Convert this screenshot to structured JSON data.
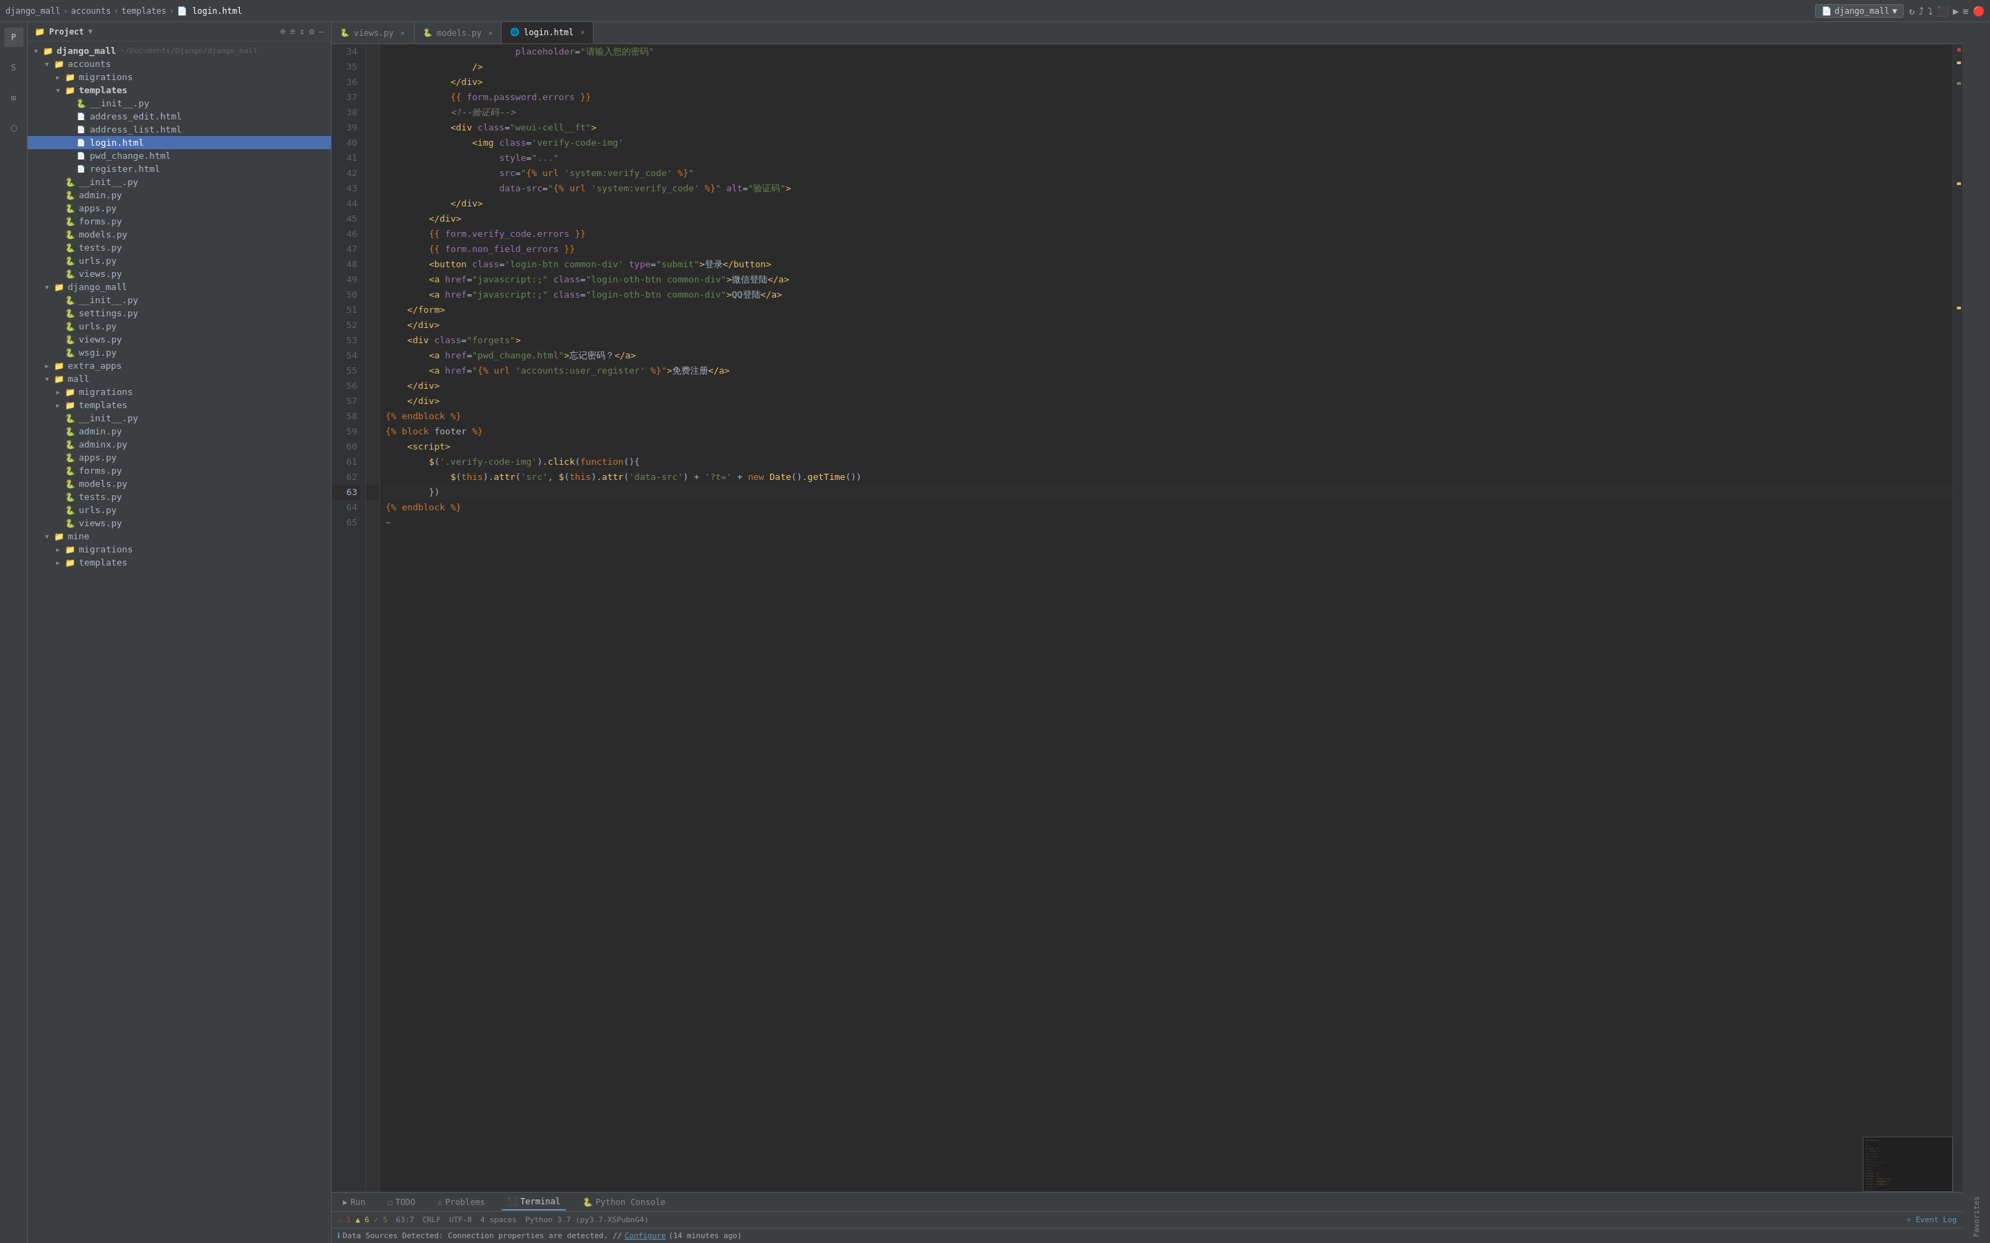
{
  "topbar": {
    "breadcrumbs": [
      "django_mall",
      "accounts",
      "templates",
      "login.html"
    ],
    "project_label": "django_mall",
    "icons": [
      "↻",
      "⤴",
      "⤵",
      "≡",
      "▼",
      "🔴"
    ]
  },
  "sidebar": {
    "header_title": "Project",
    "icons": [
      "⊕",
      "≡",
      "↕",
      "⚙",
      "—"
    ],
    "tree": [
      {
        "id": "django_mall_root",
        "label": "django_mall",
        "indent": 0,
        "type": "folder",
        "expanded": true,
        "suffix": "~/Documents/Django/django_mall"
      },
      {
        "id": "accounts",
        "label": "accounts",
        "indent": 1,
        "type": "folder",
        "expanded": true
      },
      {
        "id": "migrations_acc",
        "label": "migrations",
        "indent": 2,
        "type": "folder",
        "expanded": false
      },
      {
        "id": "templates_acc",
        "label": "templates",
        "indent": 2,
        "type": "folder",
        "expanded": true
      },
      {
        "id": "__init__py_tmpl",
        "label": "__init__.py",
        "indent": 3,
        "type": "file_blue"
      },
      {
        "id": "address_edit",
        "label": "address_edit.html",
        "indent": 3,
        "type": "file_orange"
      },
      {
        "id": "address_list",
        "label": "address_list.html",
        "indent": 3,
        "type": "file_orange"
      },
      {
        "id": "login_html",
        "label": "login.html",
        "indent": 3,
        "type": "file_orange",
        "selected": true
      },
      {
        "id": "pwd_change",
        "label": "pwd_change.html",
        "indent": 3,
        "type": "file_orange"
      },
      {
        "id": "register",
        "label": "register.html",
        "indent": 3,
        "type": "file_orange"
      },
      {
        "id": "__init__py_acc",
        "label": "__init__.py",
        "indent": 2,
        "type": "file_blue"
      },
      {
        "id": "admin_acc",
        "label": "admin.py",
        "indent": 2,
        "type": "file_blue"
      },
      {
        "id": "apps_acc",
        "label": "apps.py",
        "indent": 2,
        "type": "file_blue"
      },
      {
        "id": "forms_acc",
        "label": "forms.py",
        "indent": 2,
        "type": "file_blue"
      },
      {
        "id": "models_acc",
        "label": "models.py",
        "indent": 2,
        "type": "file_blue"
      },
      {
        "id": "tests_acc",
        "label": "tests.py",
        "indent": 2,
        "type": "file_blue"
      },
      {
        "id": "urls_acc",
        "label": "urls.py",
        "indent": 2,
        "type": "file_blue"
      },
      {
        "id": "views_acc",
        "label": "views.py",
        "indent": 2,
        "type": "file_blue"
      },
      {
        "id": "django_mall_pkg",
        "label": "django_mall",
        "indent": 1,
        "type": "folder",
        "expanded": true
      },
      {
        "id": "__init__py_dm",
        "label": "__init__.py",
        "indent": 2,
        "type": "file_blue"
      },
      {
        "id": "settings_dm",
        "label": "settings.py",
        "indent": 2,
        "type": "file_blue"
      },
      {
        "id": "urls_dm",
        "label": "urls.py",
        "indent": 2,
        "type": "file_blue"
      },
      {
        "id": "views_dm",
        "label": "views.py",
        "indent": 2,
        "type": "file_blue"
      },
      {
        "id": "wsgi_dm",
        "label": "wsgi.py",
        "indent": 2,
        "type": "file_blue"
      },
      {
        "id": "extra_apps",
        "label": "extra_apps",
        "indent": 1,
        "type": "folder",
        "expanded": false
      },
      {
        "id": "mall",
        "label": "mall",
        "indent": 1,
        "type": "folder",
        "expanded": true
      },
      {
        "id": "migrations_mall",
        "label": "migrations",
        "indent": 2,
        "type": "folder",
        "expanded": false
      },
      {
        "id": "templates_mall",
        "label": "templates",
        "indent": 2,
        "type": "folder",
        "expanded": false
      },
      {
        "id": "__init__py_mall",
        "label": "__init__.py",
        "indent": 2,
        "type": "file_blue"
      },
      {
        "id": "admin_mall",
        "label": "admin.py",
        "indent": 2,
        "type": "file_blue"
      },
      {
        "id": "adminx_mall",
        "label": "adminx.py",
        "indent": 2,
        "type": "file_blue"
      },
      {
        "id": "apps_mall",
        "label": "apps.py",
        "indent": 2,
        "type": "file_blue"
      },
      {
        "id": "forms_mall",
        "label": "forms.py",
        "indent": 2,
        "type": "file_blue"
      },
      {
        "id": "models_mall",
        "label": "models.py",
        "indent": 2,
        "type": "file_blue"
      },
      {
        "id": "tests_mall",
        "label": "tests.py",
        "indent": 2,
        "type": "file_blue"
      },
      {
        "id": "urls_mall",
        "label": "urls.py",
        "indent": 2,
        "type": "file_blue"
      },
      {
        "id": "views_mall",
        "label": "views.py",
        "indent": 2,
        "type": "file_blue"
      },
      {
        "id": "mine",
        "label": "mine",
        "indent": 1,
        "type": "folder",
        "expanded": true
      },
      {
        "id": "migrations_mine",
        "label": "migrations",
        "indent": 2,
        "type": "folder",
        "expanded": false
      },
      {
        "id": "templates_mine",
        "label": "templates",
        "indent": 2,
        "type": "folder",
        "expanded": false
      }
    ]
  },
  "tabs": [
    {
      "id": "views_py",
      "label": "views.py",
      "icon": "🐍",
      "active": false,
      "closeable": true
    },
    {
      "id": "models_py",
      "label": "models.py",
      "icon": "🐍",
      "active": false,
      "closeable": true
    },
    {
      "id": "login_html",
      "label": "login.html",
      "icon": "🌐",
      "active": true,
      "closeable": true
    }
  ],
  "editor": {
    "lines": [
      {
        "num": 34,
        "content": "                        placeholder=\"请输入您的密码\"",
        "type": "attr_val"
      },
      {
        "num": 35,
        "content": "                />",
        "type": "plain"
      },
      {
        "num": 36,
        "content": "            </div>",
        "type": "tag"
      },
      {
        "num": 37,
        "content": "            {{ form.password.errors }}",
        "type": "tmpl"
      },
      {
        "num": 38,
        "content": "            <!--验证码-->",
        "type": "comment"
      },
      {
        "num": 39,
        "content": "            <div class=\"weui-cell__ft\">",
        "type": "tag_attr"
      },
      {
        "num": 40,
        "content": "                <img class='verify-code-img'",
        "type": "tag_attr"
      },
      {
        "num": 41,
        "content": "                     style=\"...\"",
        "type": "attr_val"
      },
      {
        "num": 42,
        "content": "                     src=\"{% url 'system:verify_code' %}\"",
        "type": "attr_tmpl"
      },
      {
        "num": 43,
        "content": "                     data-src=\"{% url 'system:verify_code' %}\" alt=\"验证码\">",
        "type": "attr_tmpl"
      },
      {
        "num": 44,
        "content": "            </div>",
        "type": "tag"
      },
      {
        "num": 45,
        "content": "        </div>",
        "type": "tag"
      },
      {
        "num": 46,
        "content": "        {{ form.verify_code.errors }}",
        "type": "tmpl"
      },
      {
        "num": 47,
        "content": "        {{ form.non_field_errors }}",
        "type": "tmpl"
      },
      {
        "num": 48,
        "content": "        <button class='login-btn common-div' type=\"submit\">登录</button>",
        "type": "tag_attr"
      },
      {
        "num": 49,
        "content": "        <a href=\"javascript:;\" class=\"login-oth-btn common-div\">微信登陆</a>",
        "type": "tag_attr"
      },
      {
        "num": 50,
        "content": "        <a href=\"javascript:;\" class=\"login-oth-btn common-div\">QQ登陆</a>",
        "type": "tag_attr"
      },
      {
        "num": 51,
        "content": "    </form>",
        "type": "tag"
      },
      {
        "num": 52,
        "content": "    </div>",
        "type": "tag"
      },
      {
        "num": 53,
        "content": "    <div class=\"forgets\">",
        "type": "tag_attr"
      },
      {
        "num": 54,
        "content": "        <a href=\"pwd_change.html\">忘记密码？</a>",
        "type": "tag_attr"
      },
      {
        "num": 55,
        "content": "        <a href=\"{% url 'accounts:user_register' %}\">免费注册</a>",
        "type": "attr_tmpl"
      },
      {
        "num": 56,
        "content": "    </div>",
        "type": "tag"
      },
      {
        "num": 57,
        "content": "    </div>",
        "type": "tag"
      },
      {
        "num": 58,
        "content": "{% endblock %}",
        "type": "tmpl_kw"
      },
      {
        "num": 59,
        "content": "{% block footer %}",
        "type": "tmpl_kw"
      },
      {
        "num": 60,
        "content": "    <script>",
        "type": "tag"
      },
      {
        "num": 61,
        "content": "        $('.verify-code-img').click(function(){",
        "type": "js"
      },
      {
        "num": 62,
        "content": "            $(this).attr('src', $(this).attr('data-src') + '?t=' + new Date().getTime())",
        "type": "js"
      },
      {
        "num": 63,
        "content": "        })",
        "type": "js",
        "highlighted": true
      },
      {
        "num": 64,
        "content": "{% endblock %}",
        "type": "tmpl_kw"
      },
      {
        "num": 65,
        "content": "",
        "type": "plain"
      }
    ],
    "cursor_line": 63,
    "cursor_col": 7
  },
  "status_bar": {
    "left": [
      {
        "id": "run",
        "label": "▶ Run"
      },
      {
        "id": "todo",
        "label": "☐ TODO"
      },
      {
        "id": "problems",
        "label": "⚠ Problems"
      },
      {
        "id": "terminal",
        "label": "⬛ Terminal"
      },
      {
        "id": "python_console",
        "label": "🐍 Python Console"
      }
    ],
    "right": [
      {
        "id": "position",
        "label": "63:7"
      },
      {
        "id": "crlf",
        "label": "CRLF"
      },
      {
        "id": "encoding",
        "label": "UTF-8"
      },
      {
        "id": "indent",
        "label": "4 spaces"
      },
      {
        "id": "python_version",
        "label": "Python 3.7 (py3.7-XSPubnG4)"
      },
      {
        "id": "event_log",
        "label": "⚡ Event Log"
      }
    ],
    "errors": {
      "error_count": 1,
      "warning_count": 6,
      "ok_count": 5
    }
  },
  "notification": {
    "text": "Data Sources Detected: Connection properties are detected. // Configure (14 minutes ago)"
  },
  "activity_bar": {
    "icons": [
      {
        "id": "project",
        "label": "Project",
        "symbol": "📁"
      },
      {
        "id": "structure",
        "label": "Structure",
        "symbol": "⊞"
      },
      {
        "id": "favorites",
        "label": "Favorites",
        "symbol": "☆"
      }
    ]
  }
}
